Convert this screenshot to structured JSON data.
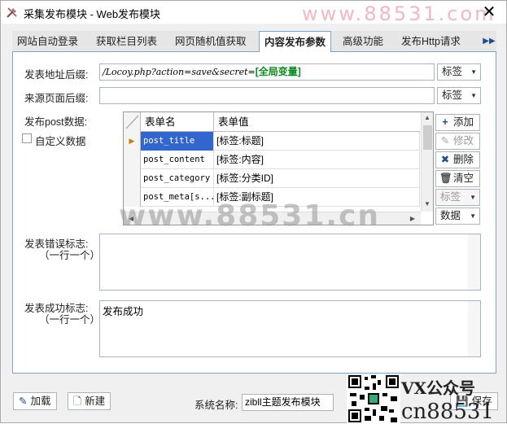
{
  "window": {
    "title": "采集发布模块 - Web发布模块",
    "watermark_top": "www.88531.com",
    "close_glyph": "✕"
  },
  "tabs": [
    {
      "label": "网站自动登录"
    },
    {
      "label": "获取栏目列表"
    },
    {
      "label": "网页随机值获取"
    },
    {
      "label": "内容发布参数",
      "active": true
    },
    {
      "label": "高级功能"
    },
    {
      "label": "发布Http请求"
    }
  ],
  "tab_scroll": "▶▶",
  "form": {
    "url_suffix_label": "发表地址后缀:",
    "url_suffix_value_prefix": "/Locoy.php?action=save&secret=",
    "url_suffix_value_tag": "[全局变量]",
    "url_suffix_dd": "标签",
    "source_suffix_label": "来源页面后缀:",
    "source_suffix_value": "",
    "source_suffix_dd": "标签",
    "post_data_label": "发布post数据:",
    "custom_data_label": "自定义数据",
    "error_label": "发表错误标志:",
    "error_sub": "（一行一个）",
    "error_value": "",
    "success_label": "发表成功标志:",
    "success_sub": "（一行一个）",
    "success_value": "发布成功"
  },
  "grid": {
    "columns": [
      "表单名",
      "表单值"
    ],
    "rows": [
      {
        "name": "post_title",
        "value": "[标签:标题]",
        "selected": true
      },
      {
        "name": "post_content",
        "value": "[标签:内容]"
      },
      {
        "name": "post_category",
        "value": "[标签:分类ID]"
      },
      {
        "name": "post_meta[s...",
        "value": "[标签:副标题]"
      }
    ]
  },
  "side_buttons": {
    "add": "添加",
    "edit": "修改",
    "delete": "删除",
    "clear": "清空",
    "tag": "标签",
    "data": "数据"
  },
  "footer": {
    "load": "加载",
    "new": "新建",
    "sysname_label": "系统名称:",
    "sysname_value": "zibll主题发布模块",
    "save": "保存"
  },
  "watermark_mid": "www.88531.cn",
  "watermark_vx": "VX公众号",
  "watermark_cn": "cn88531"
}
